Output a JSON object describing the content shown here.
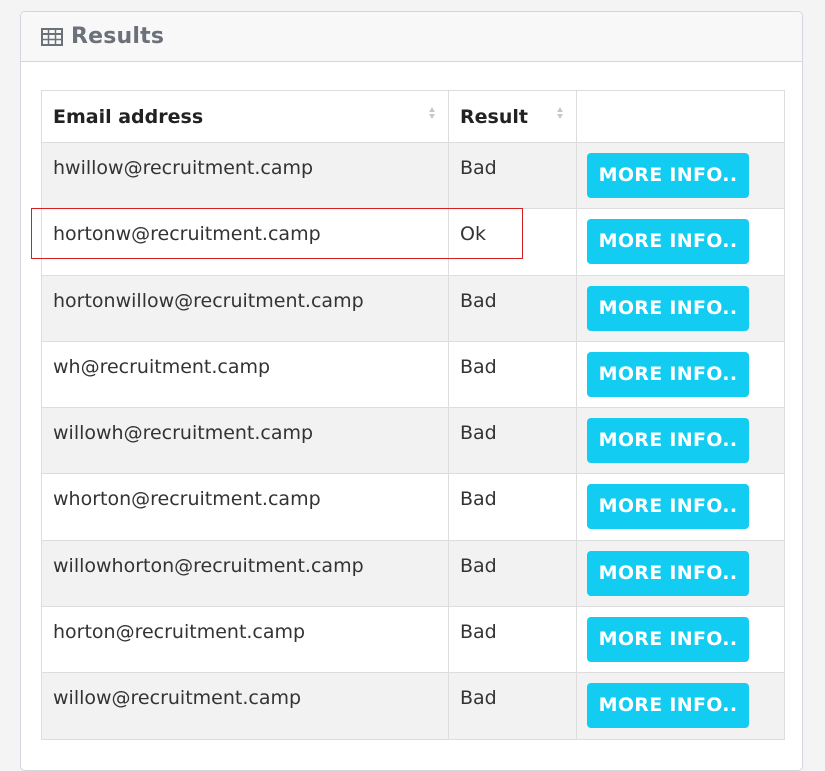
{
  "panel": {
    "title": "Results",
    "icon": "table-icon"
  },
  "table": {
    "headers": [
      "Email address",
      "Result",
      ""
    ],
    "rows": [
      {
        "email": "hwillow@recruitment.camp",
        "result": "Bad",
        "button": "MORE INFO.."
      },
      {
        "email": "hortonw@recruitment.camp",
        "result": "Ok",
        "button": "MORE INFO.."
      },
      {
        "email": "hortonwillow@recruitment.camp",
        "result": "Bad",
        "button": "MORE INFO.."
      },
      {
        "email": "wh@recruitment.camp",
        "result": "Bad",
        "button": "MORE INFO.."
      },
      {
        "email": "willowh@recruitment.camp",
        "result": "Bad",
        "button": "MORE INFO.."
      },
      {
        "email": "whorton@recruitment.camp",
        "result": "Bad",
        "button": "MORE INFO.."
      },
      {
        "email": "willowhorton@recruitment.camp",
        "result": "Bad",
        "button": "MORE INFO.."
      },
      {
        "email": "horton@recruitment.camp",
        "result": "Bad",
        "button": "MORE INFO.."
      },
      {
        "email": "willow@recruitment.camp",
        "result": "Bad",
        "button": "MORE INFO.."
      }
    ]
  },
  "colors": {
    "button": "#12cdf1",
    "highlight": "#d62020",
    "header_text": "#6b7079"
  }
}
